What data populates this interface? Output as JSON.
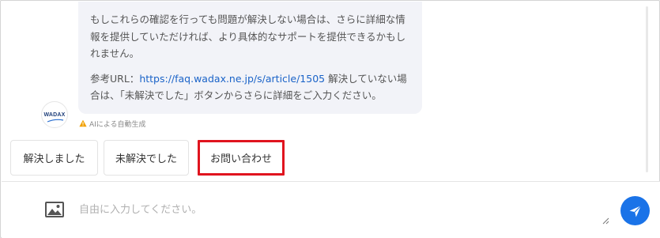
{
  "message": {
    "paragraph1": "もしこれらの確認を行っても問題が解決しない場合は、さらに詳細な情報を提供していただければ、より具体的なサポートを提供できるかもしれません。",
    "ref_prefix": "参考URL：",
    "ref_link": "https://faq.wadax.ne.jp/s/article/1505",
    "ref_suffix": " 解決していない場合は、「未解決でした」ボタンからさらに詳細をご入力ください。"
  },
  "avatar": {
    "logo_text": "WADAX"
  },
  "ai_note": {
    "text": "AIによる自動生成",
    "icon": "warning-icon"
  },
  "quick_replies": [
    {
      "label": "解決しました"
    },
    {
      "label": "未解決でした"
    },
    {
      "label": "お問い合わせ"
    }
  ],
  "composer": {
    "placeholder": "自由に入力してください。",
    "value": "",
    "attach_icon": "image-icon",
    "send_icon": "paper-plane-icon"
  },
  "colors": {
    "accent": "#1a73e8",
    "link": "#1a63c8",
    "highlight_border": "#e0141e",
    "bubble_bg": "#f2f3f8"
  }
}
